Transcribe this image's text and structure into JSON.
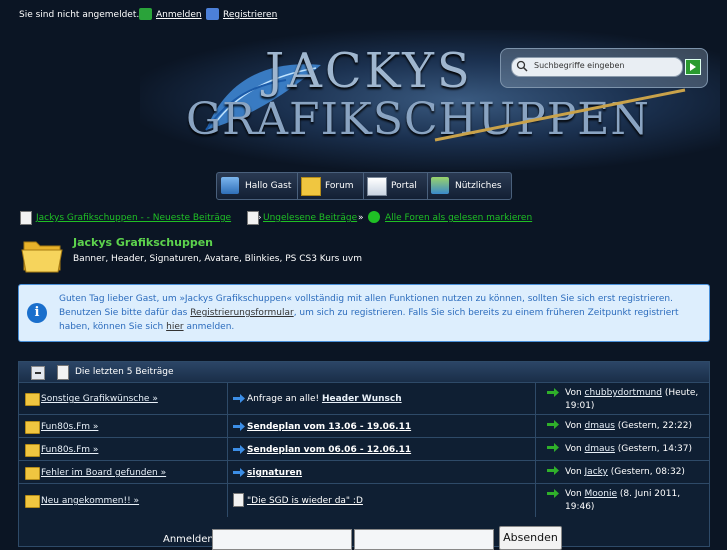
{
  "topbar": {
    "status": "Sie sind nicht angemeldet.",
    "login_label": "Anmelden",
    "register_label": "Registrieren"
  },
  "logo": {
    "line1": "JACKYS",
    "line2": "GRAFIKSCHUPPEN"
  },
  "search": {
    "placeholder": "Suchbegriffe eingeben"
  },
  "nav": {
    "items": [
      {
        "label": "Hallo Gast",
        "icon": "hello-icon"
      },
      {
        "label": "Forum",
        "icon": "folder-icon"
      },
      {
        "label": "Portal",
        "icon": "portal-icon"
      },
      {
        "label": "Nützliches",
        "icon": "tools-icon"
      }
    ]
  },
  "breadcrumb": {
    "item1": "Jackys Grafikschuppen - - Neueste Beiträge",
    "item2": "Ungelesene Beiträge",
    "item3": "Alle Foren als gelesen markieren",
    "sep": "»"
  },
  "site": {
    "title": "Jackys Grafikschuppen",
    "description": "Banner, Header, Signaturen, Avatare, Blinkies, PS CS3 Kurs uvm"
  },
  "info": {
    "text_before": "Guten Tag lieber Gast, um »Jackys Grafikschuppen« vollständig mit allen Funktionen nutzen zu können, sollten Sie sich erst registrieren. Benutzen Sie bitte dafür das ",
    "form_link": "Registrierungsformular",
    "text_middle": ", um sich zu registrieren. Falls Sie sich bereits zu einem früheren Zeitpunkt registriert haben, können Sie sich ",
    "here_link": "hier",
    "text_after": " anmelden."
  },
  "posts": {
    "title": "Die letzten 5 Beiträge",
    "rows": [
      {
        "forum": "Sonstige Grafikwünsche »",
        "thread": "Anfrage an alle! Header Wunsch",
        "prefix": "Von ",
        "user": "chubbydortmund",
        "time": " (Heute, 19:01)"
      },
      {
        "forum": "Fun80s.Fm »",
        "thread": "Sendeplan vom 13.06 - 19.06.11",
        "prefix": "Von ",
        "user": "dmaus",
        "time": " (Gestern, 22:22)"
      },
      {
        "forum": "Fun80s.Fm »",
        "thread": "Sendeplan vom 06.06 - 12.06.11",
        "prefix": "Von ",
        "user": "dmaus",
        "time": " (Gestern, 14:37)"
      },
      {
        "forum": "Fehler im Board gefunden »",
        "thread": "signaturen",
        "prefix": "Von ",
        "user": "Jacky",
        "time": " (Gestern, 08:32)"
      },
      {
        "forum": "Neu angekommen!! »",
        "thread": "\"Die SGD is wieder da\" :D",
        "prefix": "Von ",
        "user": "Moonie",
        "time": " (8. Juni 2011, 19:46)"
      }
    ]
  },
  "login": {
    "label": "Anmelden:",
    "submit": "Absenden"
  },
  "colors": {
    "accent_green": "#1fbf25",
    "info_bg": "#ddeefd",
    "page_bg": "#0b1524"
  }
}
